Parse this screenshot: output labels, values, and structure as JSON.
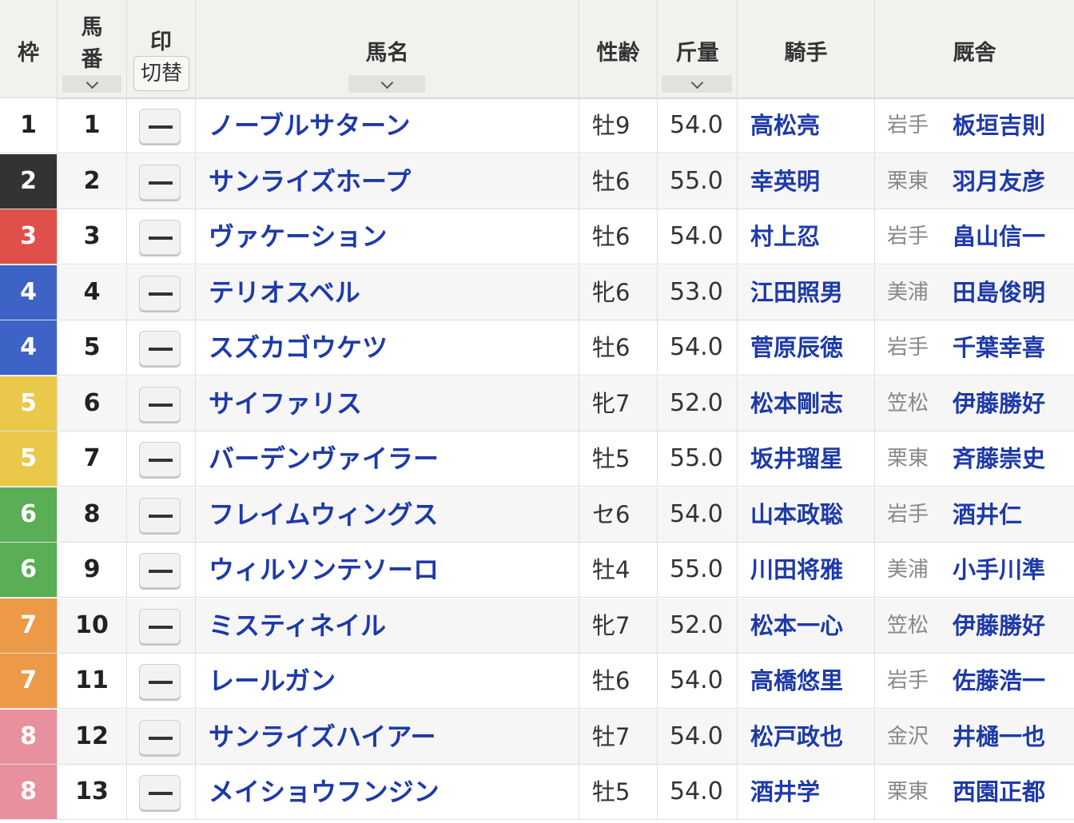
{
  "header": {
    "waku": "枠",
    "umaban_line1": "馬",
    "umaban_line2": "番",
    "mark": "印",
    "mark_toggle": "切替",
    "name": "馬名",
    "sexage": "性齢",
    "weight": "斤量",
    "jockey": "騎手",
    "stable": "厩舎"
  },
  "mark_placeholder": "--",
  "waku_colors": {
    "1": {
      "bg": "#ffffff",
      "fg": "#222222"
    },
    "2": {
      "bg": "#333333",
      "fg": "#ffffff"
    },
    "3": {
      "bg": "#e0504a",
      "fg": "#ffffff"
    },
    "4": {
      "bg": "#3d63c7",
      "fg": "#ffffff"
    },
    "5": {
      "bg": "#e9c84a",
      "fg": "#ffffff"
    },
    "6": {
      "bg": "#5aae55",
      "fg": "#ffffff"
    },
    "7": {
      "bg": "#ec9a48",
      "fg": "#ffffff"
    },
    "8": {
      "bg": "#e8909e",
      "fg": "#ffffff"
    }
  },
  "rows": [
    {
      "waku": "1",
      "umaban": "1",
      "name": "ノーブルサターン",
      "sexage": "牡9",
      "weight": "54.0",
      "jockey": "高松亮",
      "region": "岩手",
      "trainer": "板垣吉則"
    },
    {
      "waku": "2",
      "umaban": "2",
      "name": "サンライズホープ",
      "sexage": "牡6",
      "weight": "55.0",
      "jockey": "幸英明",
      "region": "栗東",
      "trainer": "羽月友彦"
    },
    {
      "waku": "3",
      "umaban": "3",
      "name": "ヴァケーション",
      "sexage": "牡6",
      "weight": "54.0",
      "jockey": "村上忍",
      "region": "岩手",
      "trainer": "畠山信一"
    },
    {
      "waku": "4",
      "umaban": "4",
      "name": "テリオスベル",
      "sexage": "牝6",
      "weight": "53.0",
      "jockey": "江田照男",
      "region": "美浦",
      "trainer": "田島俊明"
    },
    {
      "waku": "4",
      "umaban": "5",
      "name": "スズカゴウケツ",
      "sexage": "牡6",
      "weight": "54.0",
      "jockey": "菅原辰徳",
      "region": "岩手",
      "trainer": "千葉幸喜"
    },
    {
      "waku": "5",
      "umaban": "6",
      "name": "サイファリス",
      "sexage": "牝7",
      "weight": "52.0",
      "jockey": "松本剛志",
      "region": "笠松",
      "trainer": "伊藤勝好"
    },
    {
      "waku": "5",
      "umaban": "7",
      "name": "バーデンヴァイラー",
      "sexage": "牡5",
      "weight": "55.0",
      "jockey": "坂井瑠星",
      "region": "栗東",
      "trainer": "斉藤崇史"
    },
    {
      "waku": "6",
      "umaban": "8",
      "name": "フレイムウィングス",
      "sexage": "セ6",
      "weight": "54.0",
      "jockey": "山本政聡",
      "region": "岩手",
      "trainer": "酒井仁"
    },
    {
      "waku": "6",
      "umaban": "9",
      "name": "ウィルソンテソーロ",
      "sexage": "牡4",
      "weight": "55.0",
      "jockey": "川田将雅",
      "region": "美浦",
      "trainer": "小手川準"
    },
    {
      "waku": "7",
      "umaban": "10",
      "name": "ミスティネイル",
      "sexage": "牝7",
      "weight": "52.0",
      "jockey": "松本一心",
      "region": "笠松",
      "trainer": "伊藤勝好"
    },
    {
      "waku": "7",
      "umaban": "11",
      "name": "レールガン",
      "sexage": "牡6",
      "weight": "54.0",
      "jockey": "高橋悠里",
      "region": "岩手",
      "trainer": "佐藤浩一"
    },
    {
      "waku": "8",
      "umaban": "12",
      "name": "サンライズハイアー",
      "sexage": "牡7",
      "weight": "54.0",
      "jockey": "松戸政也",
      "region": "金沢",
      "trainer": "井樋一也"
    },
    {
      "waku": "8",
      "umaban": "13",
      "name": "メイショウフンジン",
      "sexage": "牡5",
      "weight": "54.0",
      "jockey": "酒井学",
      "region": "栗東",
      "trainer": "西園正都"
    }
  ]
}
